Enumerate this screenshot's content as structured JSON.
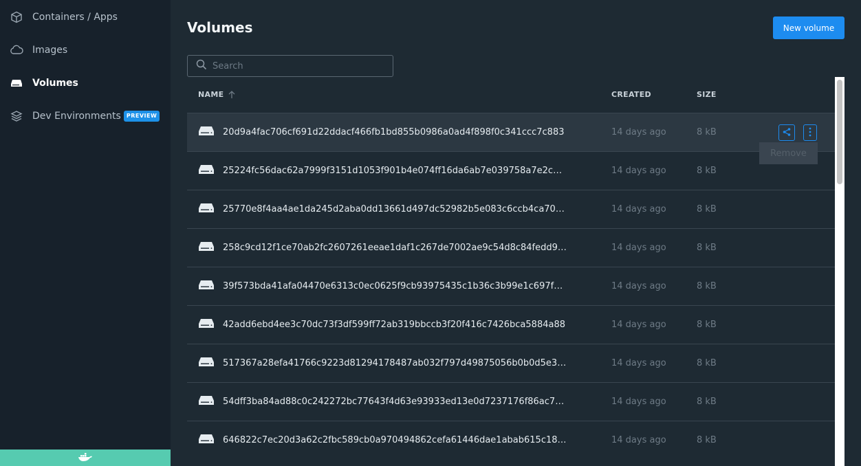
{
  "sidebar": {
    "items": [
      {
        "label": "Containers / Apps",
        "icon": "cube-icon"
      },
      {
        "label": "Images",
        "icon": "cloud-icon"
      },
      {
        "label": "Volumes",
        "icon": "hard-drive-icon",
        "active": true
      },
      {
        "label": "Dev Environments",
        "icon": "dev-env-icon",
        "badge": "PREVIEW"
      }
    ],
    "status_color": "#56cbb0",
    "status_icon": "docker-whale-icon"
  },
  "main": {
    "title": "Volumes",
    "new_button_label": "New volume",
    "search_placeholder": "Search",
    "columns": {
      "name": "NAME",
      "created": "CREATED",
      "size": "SIZE"
    },
    "sort_icon": "arrow-up-icon",
    "tooltip": "Remove",
    "rows": [
      {
        "name": "20d9a4fac706cf691d22ddacf466fb1bd855b0986a0ad4f898f0c341ccc7c883",
        "created": "14 days ago",
        "size": "8 kB"
      },
      {
        "name": "25224fc56dac62a7999f3151d1053f901b4e074ff16da6ab7e039758a7e2c1…",
        "created": "14 days ago",
        "size": "8 kB"
      },
      {
        "name": "25770e8f4aa4ae1da245d2aba0dd13661d497dc52982b5e083c6ccb4ca700…",
        "created": "14 days ago",
        "size": "8 kB"
      },
      {
        "name": "258c9cd12f1ce70ab2fc2607261eeae1daf1c267de7002ae9c54d8c84fedd9…",
        "created": "14 days ago",
        "size": "8 kB"
      },
      {
        "name": "39f573bda41afa04470e6313c0ec0625f9cb93975435c1b36c3b99e1c697fd…",
        "created": "14 days ago",
        "size": "8 kB"
      },
      {
        "name": "42add6ebd4ee3c70dc73f3df599ff72ab319bbccb3f20f416c7426bca5884a88",
        "created": "14 days ago",
        "size": "8 kB"
      },
      {
        "name": "517367a28efa41766c9223d81294178487ab032f797d49875056b0b0d5e3d…",
        "created": "14 days ago",
        "size": "8 kB"
      },
      {
        "name": "54dff3ba84ad88c0c242272bc77643f4d63e93933ed13e0d7237176f86ac71…",
        "created": "14 days ago",
        "size": "8 kB"
      },
      {
        "name": "646822c7ec20d3a62c2fbc589cb0a970494862cefa61446dae1abab615c18…",
        "created": "14 days ago",
        "size": "8 kB"
      }
    ]
  },
  "colors": {
    "accent": "#1d8cf0",
    "sidebar_bg": "#17212b",
    "main_bg": "#1e2a33",
    "badge": "#1d91e8"
  }
}
